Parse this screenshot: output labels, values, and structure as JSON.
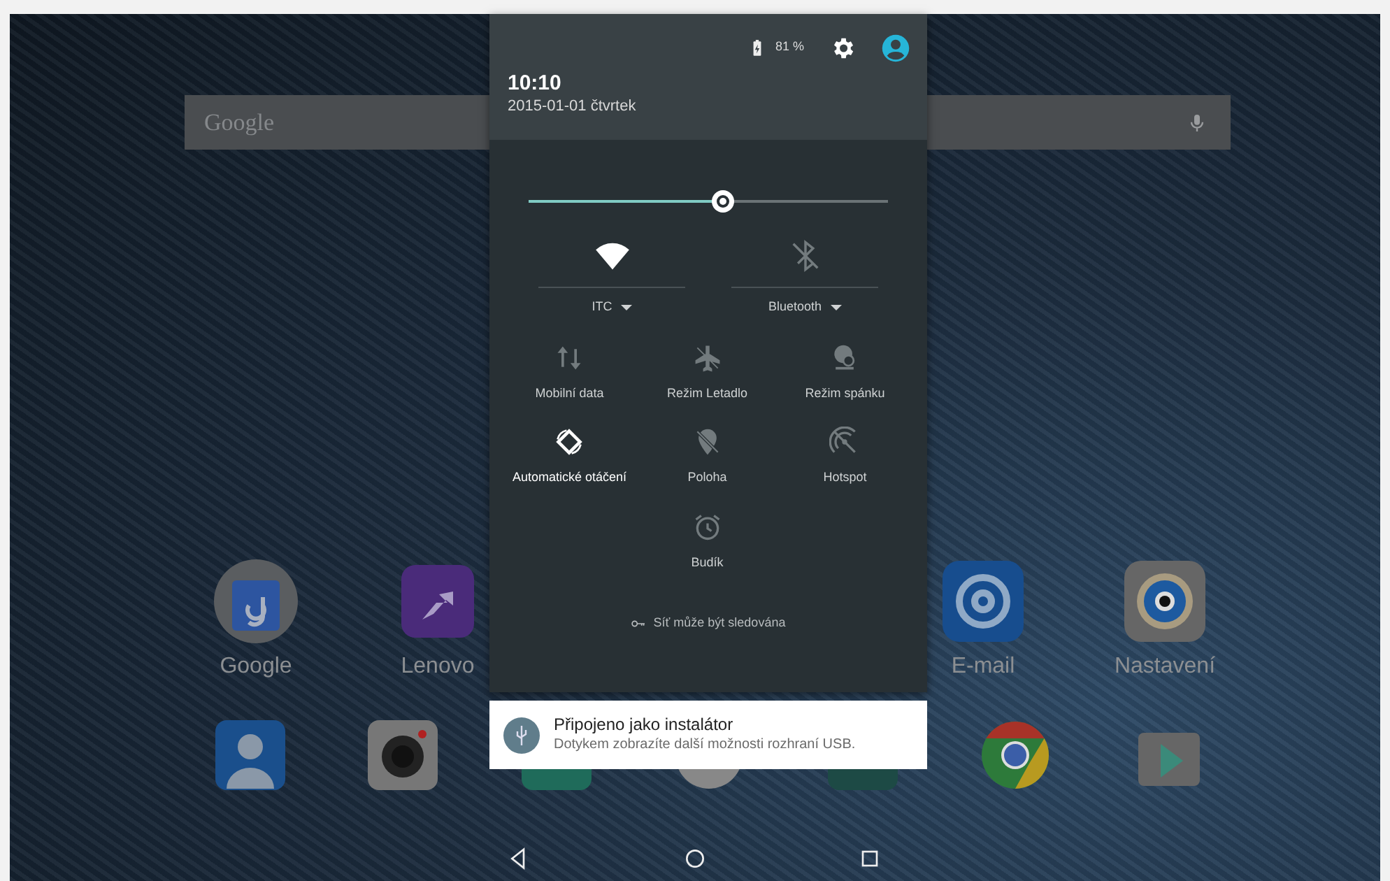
{
  "home": {
    "search": {
      "placeholder": "Google"
    },
    "apps": [
      {
        "label": "Google",
        "kind": "folder"
      },
      {
        "label": "Lenovo",
        "kind": "lenovo"
      },
      {
        "label": "E-mail",
        "kind": "email"
      },
      {
        "label": "Nastavení",
        "kind": "settings"
      }
    ],
    "dock": [
      {
        "kind": "contacts"
      },
      {
        "kind": "camera"
      },
      {
        "kind": "green"
      },
      {
        "kind": "drawer"
      },
      {
        "kind": "teal"
      },
      {
        "kind": "chrome"
      },
      {
        "kind": "store"
      }
    ]
  },
  "status": {
    "battery": "81 %"
  },
  "header": {
    "time": "10:10",
    "date": "2015-01-01 čtvrtek"
  },
  "brightness": {
    "level": 0.54
  },
  "big_tiles": [
    {
      "kind": "wifi",
      "label": "ITC",
      "on": true
    },
    {
      "kind": "bluetooth",
      "label": "Bluetooth",
      "on": false
    }
  ],
  "tiles": [
    {
      "kind": "data",
      "label": "Mobilní data",
      "on": false
    },
    {
      "kind": "airplane",
      "label": "Režim Letadlo",
      "on": false
    },
    {
      "kind": "sleep",
      "label": "Režim spánku",
      "on": false
    },
    {
      "kind": "rotate",
      "label": "Automatické otáčení",
      "on": true
    },
    {
      "kind": "location",
      "label": "Poloha",
      "on": false
    },
    {
      "kind": "hotspot",
      "label": "Hotspot",
      "on": false
    },
    {
      "kind": "alarm",
      "label": "Budík",
      "on": false
    }
  ],
  "vpn_note": "Síť může být sledována",
  "notification": {
    "title": "Připojeno jako instalátor",
    "text": "Dotykem zobrazíte další možnosti rozhraní USB."
  }
}
